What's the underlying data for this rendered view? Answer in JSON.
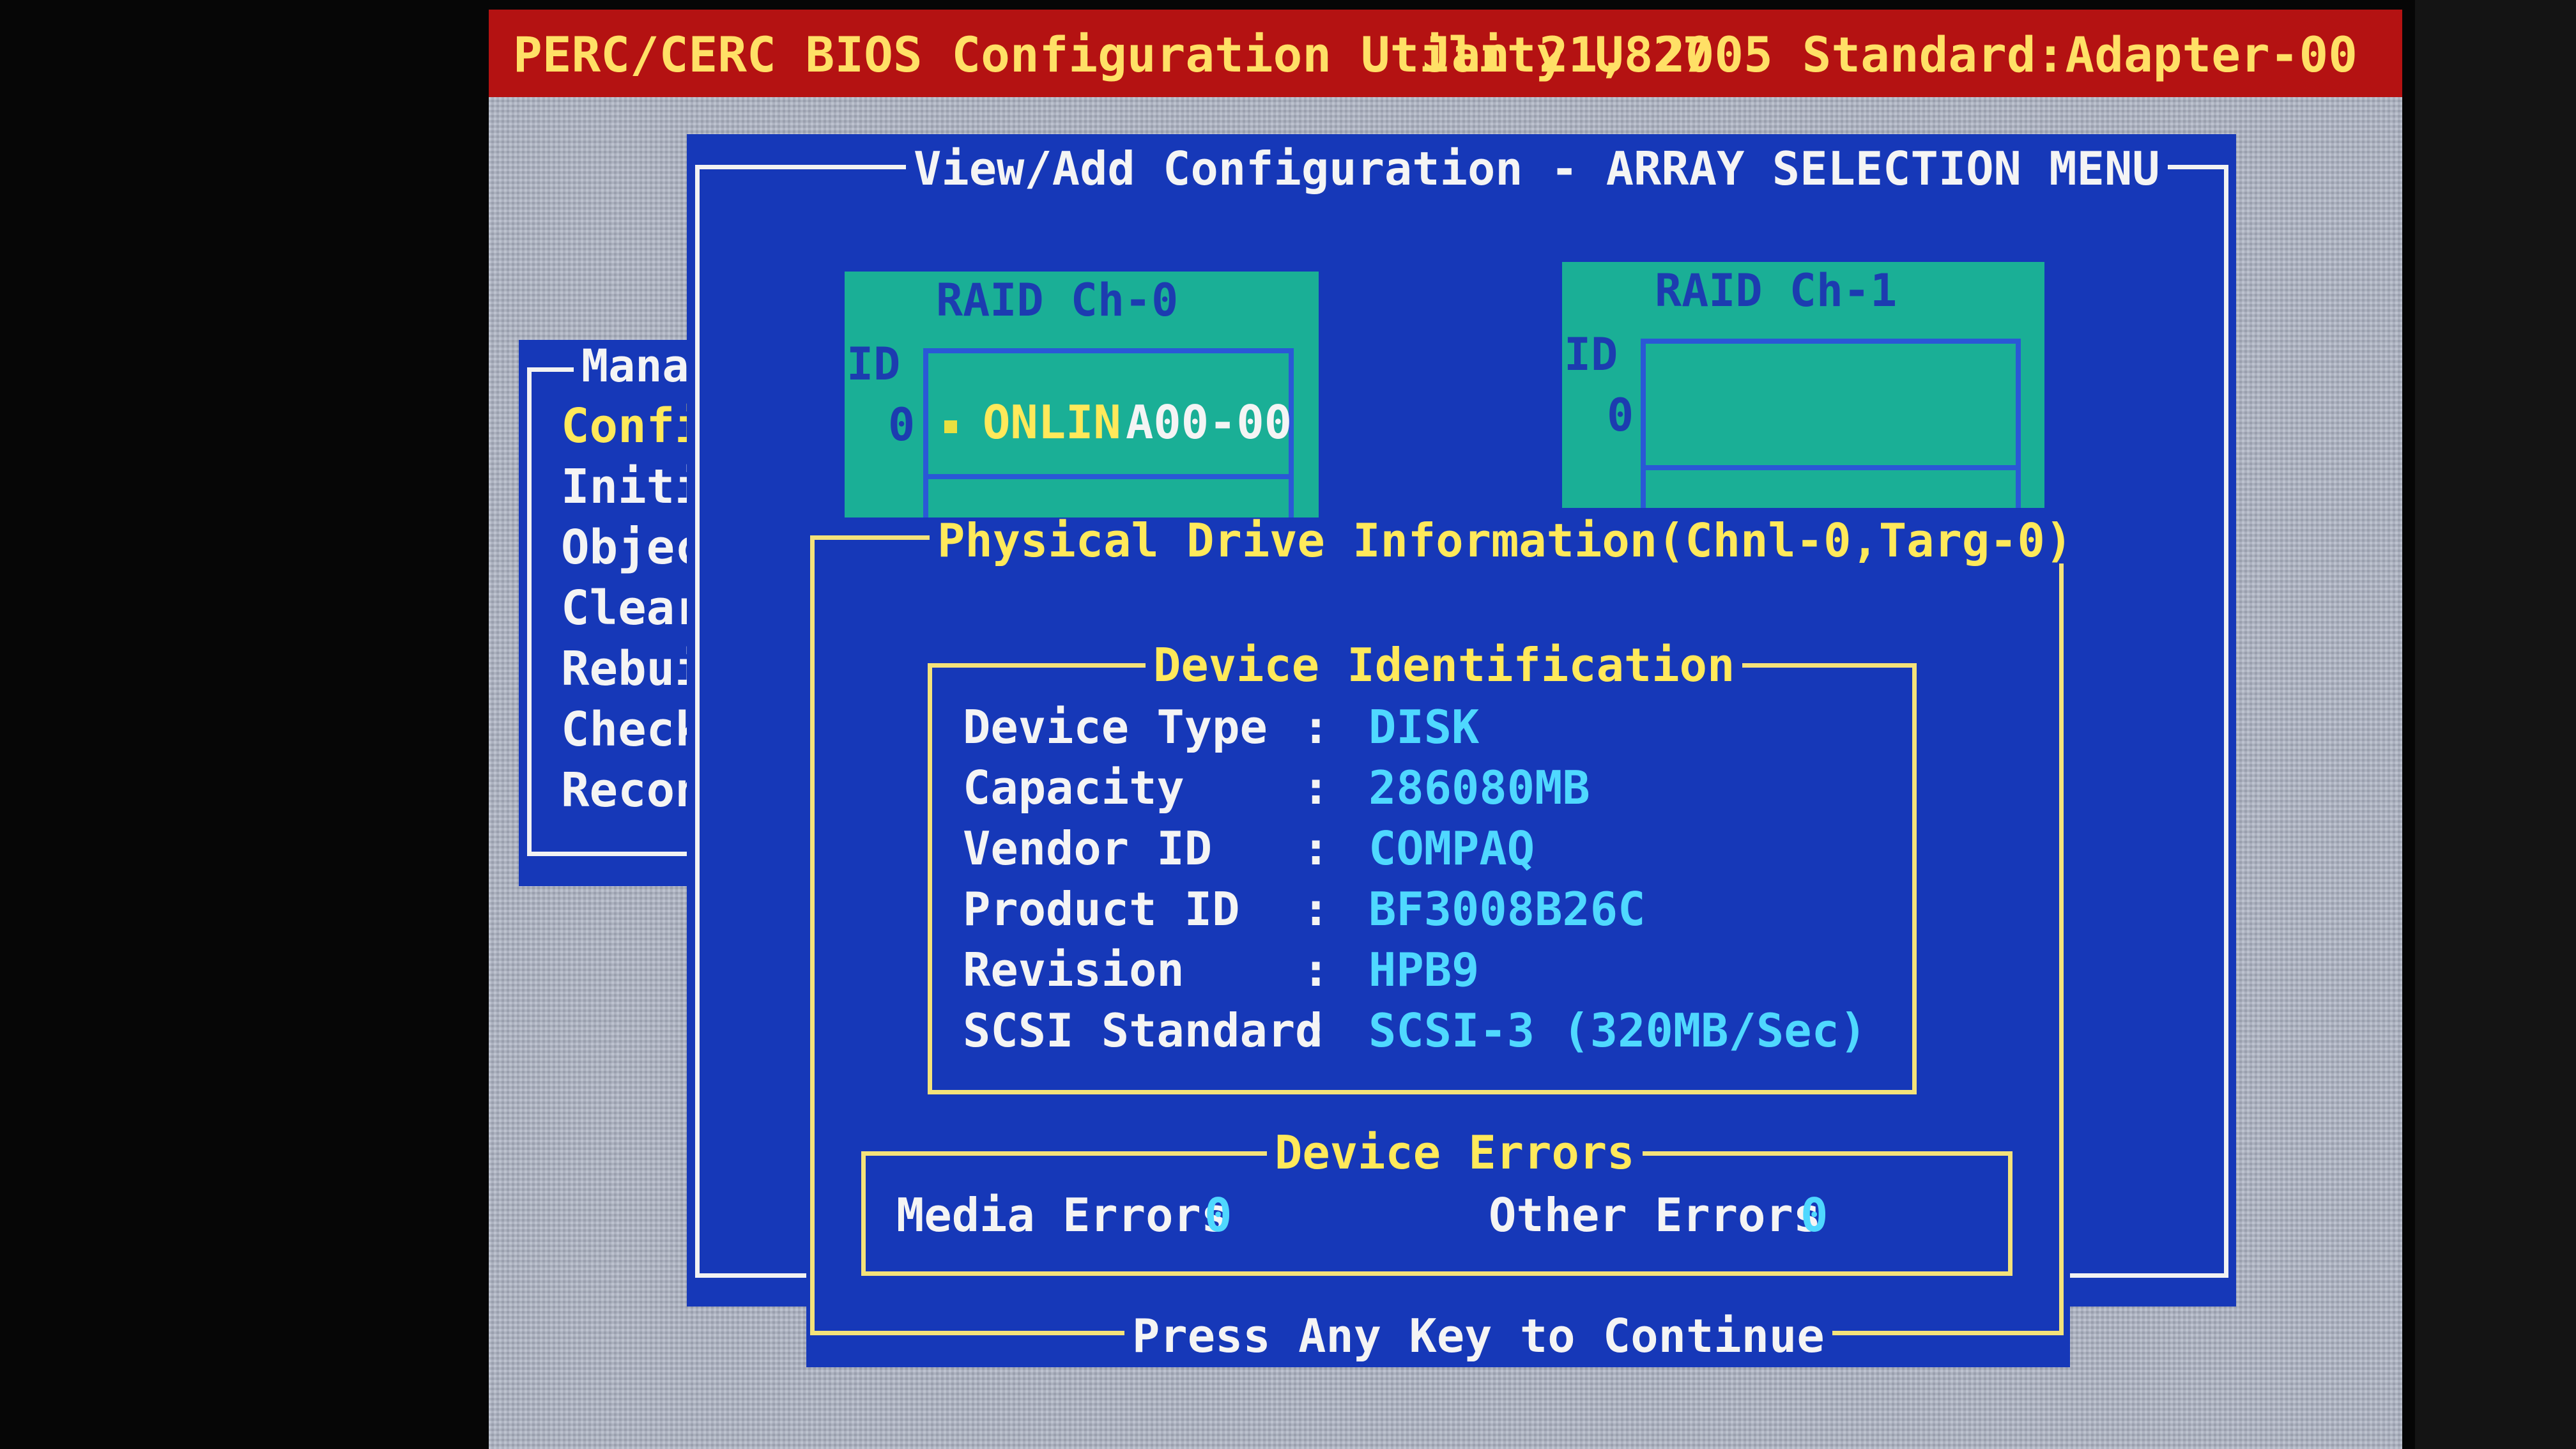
{
  "header": {
    "title": "PERC/CERC BIOS Configuration Utility U827",
    "date_adapter": "Jan 21, 2005 Standard:Adapter-00"
  },
  "main_menu": {
    "title": "Mana",
    "items": [
      "Confi",
      "Initi",
      "Objec",
      "Clear",
      "Rebui",
      "Check",
      "Recon"
    ],
    "selected_index": 0
  },
  "array_menu": {
    "title": "View/Add Configuration - ARRAY SELECTION MENU",
    "channels": [
      {
        "title": "RAID Ch-0",
        "id_label": "ID",
        "id_value": "0",
        "drive_state": "ONLIN",
        "drive_array": "A00-00"
      },
      {
        "title": "RAID Ch-1",
        "id_label": "ID",
        "id_value": "0"
      }
    ]
  },
  "drive_info": {
    "title": "Physical Drive Information(Chnl-0,Targ-0)",
    "device_identification": {
      "title": "Device Identification",
      "rows": [
        {
          "label": "Device Type",
          "sep": ":",
          "value": "DISK"
        },
        {
          "label": "Capacity",
          "sep": ":",
          "value": "286080MB"
        },
        {
          "label": "Vendor ID",
          "sep": ":",
          "value": "COMPAQ"
        },
        {
          "label": "Product ID",
          "sep": ":",
          "value": "BF3008B26C"
        },
        {
          "label": "Revision",
          "sep": ":",
          "value": "HPB9"
        },
        {
          "label": "SCSI Standard",
          "sep": ":",
          "value": "SCSI-3 (320MB/Sec)"
        }
      ]
    },
    "device_errors": {
      "title": "Device Errors",
      "media_label": "Media Errors",
      "media_value": "0",
      "other_label": "Other Errors",
      "other_value": "0"
    },
    "footer": "Press Any Key to Continue"
  },
  "colors": {
    "background_blue": "#1638b8",
    "header_red": "#b41212",
    "text_yellow": "#ffe95a",
    "value_cyan": "#4fd8ff",
    "teal": "#1aaf96"
  }
}
